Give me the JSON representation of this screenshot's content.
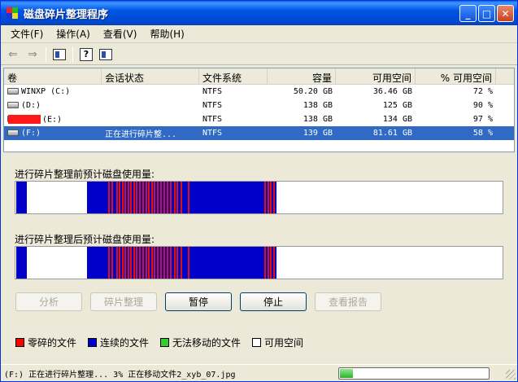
{
  "window": {
    "title": "磁盘碎片整理程序"
  },
  "menu": [
    {
      "label": "文件(F)"
    },
    {
      "label": "操作(A)"
    },
    {
      "label": "查看(V)"
    },
    {
      "label": "帮助(H)"
    }
  ],
  "columns": [
    "卷",
    "会话状态",
    "文件系统",
    "容量",
    "可用空间",
    "% 可用空间"
  ],
  "volumes": [
    {
      "name": "WINXP (C:)",
      "status": "",
      "fs": "NTFS",
      "capacity": "50.20 GB",
      "free": "36.46 GB",
      "pct": "72 %"
    },
    {
      "name": "(D:)",
      "status": "",
      "fs": "NTFS",
      "capacity": "138 GB",
      "free": "125 GB",
      "pct": "90 %"
    },
    {
      "name": "(E:)",
      "status": "",
      "fs": "NTFS",
      "capacity": "138 GB",
      "free": "134 GB",
      "pct": "97 %"
    },
    {
      "name": "(F:)",
      "status": "正在进行碎片整...",
      "fs": "NTFS",
      "capacity": "139 GB",
      "free": "81.61 GB",
      "pct": "58 %"
    }
  ],
  "before_label": "进行碎片整理前预计磁盘使用量:",
  "after_label": "进行碎片整理后预计磁盘使用量:",
  "buttons": {
    "analyze": "分析",
    "defrag": "碎片整理",
    "pause": "暂停",
    "stop": "停止",
    "report": "查看报告"
  },
  "legend": [
    {
      "label": "零碎的文件",
      "color": "#ff0000"
    },
    {
      "label": "连续的文件",
      "color": "#0000cc"
    },
    {
      "label": "无法移动的文件",
      "color": "#33cc33"
    },
    {
      "label": "可用空间",
      "color": "#ffffff"
    }
  ],
  "status": {
    "text": "(F:) 正在进行碎片整理... 3%  正在移动文件2_xyb_07.jpg",
    "progress": 0.03
  },
  "colors": {
    "fragmented": "#e01010",
    "contiguous": "#0000c8",
    "selection": "#316ac5",
    "titlebar": "#0055e5"
  }
}
